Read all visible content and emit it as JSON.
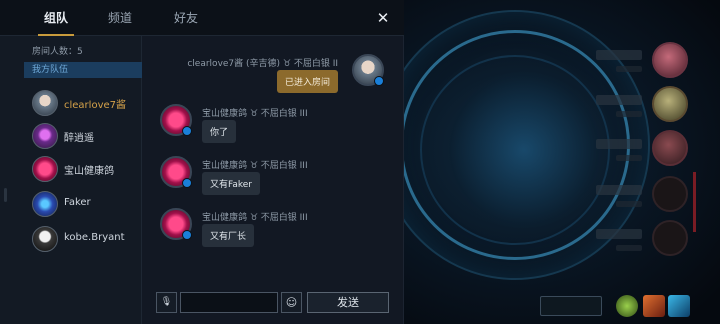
{
  "tabs": [
    {
      "label": "组队"
    },
    {
      "label": "频道"
    },
    {
      "label": "好友"
    }
  ],
  "close_glyph": "✕",
  "sidebar": {
    "room_count": "房间人数：5",
    "team_header": "我方队伍",
    "members": [
      {
        "name": "clearlove7酱",
        "highlight": true
      },
      {
        "name": "醉逍遥"
      },
      {
        "name": "宝山健康鸽"
      },
      {
        "name": "Faker"
      },
      {
        "name": "kobe.Bryant"
      }
    ]
  },
  "messages": [
    {
      "sender": "clearlove7酱 (辛吉德) ♉ 不屈白银 II",
      "text": "已进入房间",
      "self": true
    },
    {
      "sender": "宝山健康鸽 ♉ 不屈白银 III",
      "text": "你了"
    },
    {
      "sender": "宝山健康鸽 ♉ 不屈白银 III",
      "text": "又有Faker"
    },
    {
      "sender": "宝山健康鸽 ♉ 不屈白银 III",
      "text": "又有厂长"
    }
  ],
  "input": {
    "voice_icon": "mic-icon",
    "emoji_icon": "smiley-icon",
    "send_label": "发送",
    "value": ""
  },
  "colors": {
    "accent_gold": "#c89b3c",
    "team_header_bg": "#1b3d5e",
    "self_bubble": "#8c6a2c"
  }
}
